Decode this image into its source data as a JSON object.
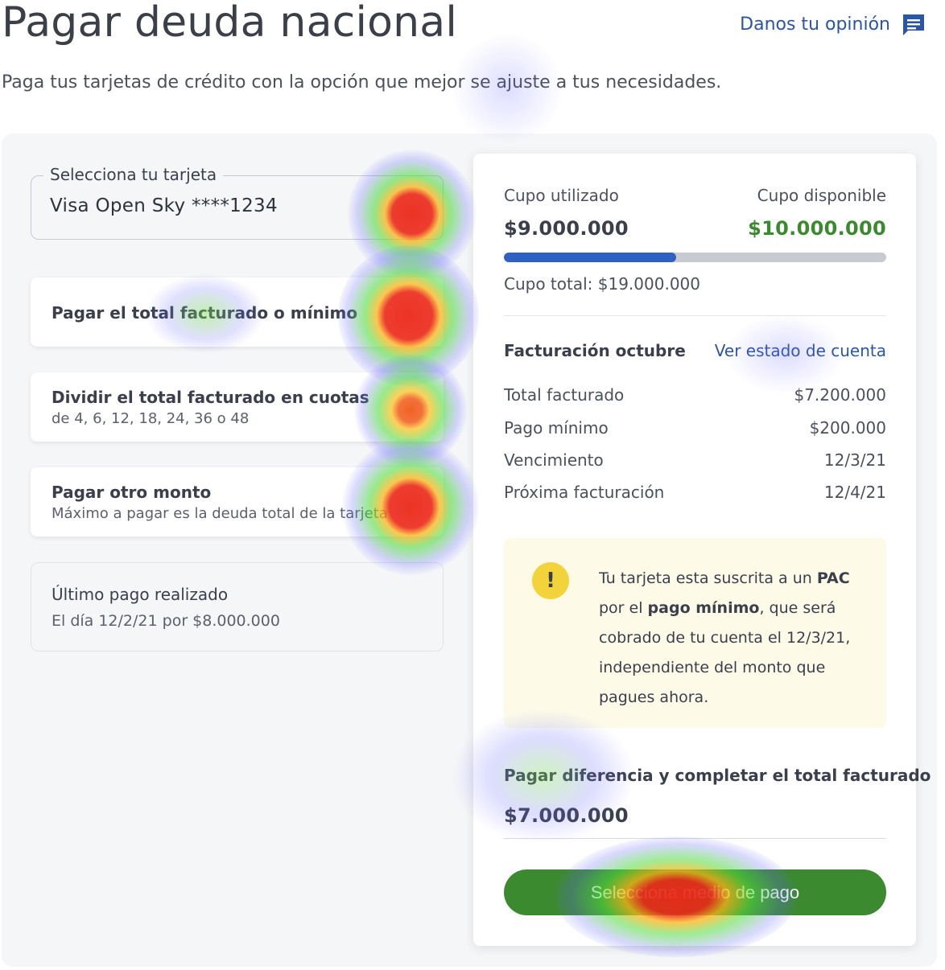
{
  "header": {
    "title": "Pagar deuda nacional",
    "feedback_label": "Danos tu opinión",
    "subtitle": "Paga tus tarjetas de crédito con la opción que mejor se ajuste a tus necesidades."
  },
  "card_select": {
    "label": "Selecciona tu tarjeta",
    "value": "Visa Open Sky ****1234"
  },
  "payment_options": [
    {
      "title": "Pagar el total facturado o mínimo",
      "subtitle": ""
    },
    {
      "title": "Dividir el total facturado en cuotas",
      "subtitle": "de 4, 6, 12, 18, 24, 36 o 48"
    },
    {
      "title": "Pagar otro monto",
      "subtitle": "Máximo a pagar es la deuda total de la tarjeta"
    }
  ],
  "last_payment": {
    "title": "Último pago realizado",
    "detail": "El día 12/2/21 por $8.000.000"
  },
  "summary": {
    "used_label": "Cupo utilizado",
    "used_value": "$9.000.000",
    "available_label": "Cupo disponible",
    "available_value": "$10.000.000",
    "usage_fraction": 0.45,
    "total_label": "Cupo total: $19.000.000",
    "billing_title": "Facturación octubre",
    "statement_link": "Ver estado de cuenta",
    "rows": [
      {
        "label": "Total facturado",
        "value": "$7.200.000"
      },
      {
        "label": "Pago mínimo",
        "value": "$200.000"
      },
      {
        "label": "Vencimiento",
        "value": "12/3/21"
      },
      {
        "label": "Próxima facturación",
        "value": "12/4/21"
      }
    ]
  },
  "notice": {
    "icon": "!",
    "t1": "Tu tarjeta esta suscrita a un ",
    "b1": "PAC",
    "t2": " por el ",
    "b2": "pago mínimo",
    "t3": ", que será cobrado de tu cuenta el 12/3/21, independiente del monto que pagues ahora."
  },
  "difference": {
    "label": "Pagar diferencia y completar el total facturado",
    "amount": "$7.000.000"
  },
  "cta_label": "Selecciona medio de pago",
  "colors": {
    "link": "#2b55a5",
    "available_green": "#3c8a2f",
    "usage_bar": "#2e61c2",
    "cta_green": "#3c8a2f",
    "notice_bg": "#fdfbe8",
    "warn_yellow": "#f2d43a"
  }
}
